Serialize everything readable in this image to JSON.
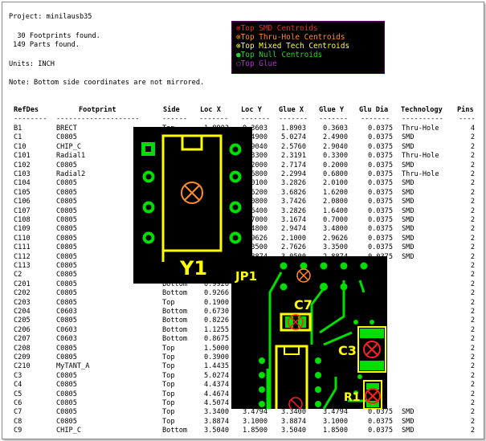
{
  "header": {
    "project": "Project: minilausb35",
    "footprints": "  30 Footprints found.",
    "parts": " 149 Parts found.",
    "units": "Units: INCH",
    "note": "Note: Bottom side coordinates are not mirrored."
  },
  "legend": [
    {
      "label": "Top SMD Centroids",
      "color": "#ff2020",
      "icon": "crossed-circle-icon"
    },
    {
      "label": "Top Thru-Hole Centroids",
      "color": "#ff8c2a",
      "icon": "crossed-circle-icon"
    },
    {
      "label": "Top Mixed Tech Centroids",
      "color": "#ffff40",
      "icon": "crossed-circle-icon"
    },
    {
      "label": "Top Null Centroids",
      "color": "#33cc33",
      "icon": "filled-circle-icon"
    },
    {
      "label": "Top Glue",
      "color": "#b030d0",
      "icon": "circle-icon"
    }
  ],
  "table": {
    "columns": [
      "RefDes",
      "Footprint",
      "Side",
      "Loc X",
      "Loc Y",
      "Glue X",
      "Glue Y",
      "Glu Dia",
      "Technology",
      "Pins"
    ],
    "dashes": [
      "--------",
      "--------------------",
      "------",
      "-------",
      "-------",
      "-------",
      "-------",
      "-------",
      "----------",
      "----"
    ],
    "rows": [
      [
        "B1",
        "BRECT",
        "Top",
        "1.8903",
        "0.3603",
        "1.8903",
        "0.3603",
        "0.0375",
        "Thru-Hole",
        "4"
      ],
      [
        "C1",
        "C0805",
        "Top",
        "5.0274",
        "2.4900",
        "5.0274",
        "2.4900",
        "0.0375",
        "SMD",
        "2"
      ],
      [
        "C10",
        "CHIP_C",
        "Top",
        "2.5760",
        "2.9040",
        "2.5760",
        "2.9040",
        "0.0375",
        "SMD",
        "2"
      ],
      [
        "C101",
        "Radial1",
        "Top",
        "2.3191",
        "0.3300",
        "2.3191",
        "0.3300",
        "0.0375",
        "Thru-Hole",
        "2"
      ],
      [
        "C102",
        "C0805",
        "Top",
        "2.7174",
        "0.2000",
        "2.7174",
        "0.2000",
        "0.0375",
        "SMD",
        "2"
      ],
      [
        "C103",
        "Radial2",
        "Top",
        "2.2994",
        "0.6800",
        "2.2994",
        "0.6800",
        "0.0375",
        "Thru-Hole",
        "2"
      ],
      [
        "C104",
        "C0805",
        "Top",
        "3.2826",
        "2.0100",
        "3.2826",
        "2.0100",
        "0.0375",
        "SMD",
        "2"
      ],
      [
        "C105",
        "C0805",
        "Top",
        "3.6826",
        "1.6200",
        "3.6826",
        "1.6200",
        "0.0375",
        "SMD",
        "2"
      ],
      [
        "C106",
        "C0805",
        "Top",
        "3.7426",
        "2.0800",
        "3.7426",
        "2.0800",
        "0.0375",
        "SMD",
        "2"
      ],
      [
        "C107",
        "C0805",
        "Top",
        "3.2826",
        "1.6400",
        "3.2826",
        "1.6400",
        "0.0375",
        "SMD",
        "2"
      ],
      [
        "C108",
        "C0805",
        "Top",
        "3.1674",
        "0.7000",
        "3.1674",
        "0.7000",
        "0.0375",
        "SMD",
        "2"
      ],
      [
        "C109",
        "C0805",
        "Top",
        "2.9474",
        "3.4800",
        "2.9474",
        "3.4800",
        "0.0375",
        "SMD",
        "2"
      ],
      [
        "C110",
        "C0805",
        "Top",
        "2.1000",
        "2.9626",
        "2.1000",
        "2.9626",
        "0.0375",
        "SMD",
        "2"
      ],
      [
        "C111",
        "C0805",
        "Top",
        "2.7626",
        "3.3500",
        "2.7626",
        "3.3500",
        "0.0375",
        "SMD",
        "2"
      ],
      [
        "C112",
        "C0805",
        "Top",
        "3.0500",
        "2.8874",
        "3.0500",
        "2.8874",
        "0.0375",
        "SMD",
        "2"
      ],
      [
        "C113",
        "C0805",
        "",
        "",
        "",
        "",
        "",
        "",
        "",
        "2"
      ],
      [
        "C2",
        "C0805",
        "",
        "",
        "",
        "",
        "",
        "",
        "",
        "2"
      ],
      [
        "C201",
        "C0805",
        "Bottom",
        "0.9926",
        "",
        "",
        "",
        "",
        "",
        "2"
      ],
      [
        "C202",
        "C0805",
        "Bottom",
        "0.9266",
        "",
        "",
        "",
        "",
        "",
        "2"
      ],
      [
        "C203",
        "C0805",
        "Top",
        "0.1900",
        "",
        "",
        "",
        "",
        "",
        "2"
      ],
      [
        "C204",
        "C0603",
        "Bottom",
        "0.6730",
        "",
        "",
        "",
        "",
        "",
        "2"
      ],
      [
        "C205",
        "C0805",
        "Bottom",
        "0.8226",
        "",
        "",
        "",
        "",
        "",
        "2"
      ],
      [
        "C206",
        "C0603",
        "Bottom",
        "1.1255",
        "",
        "",
        "",
        "",
        "",
        "2"
      ],
      [
        "C207",
        "C0603",
        "Bottom",
        "0.8675",
        "",
        "",
        "",
        "",
        "",
        "2"
      ],
      [
        "C208",
        "C0805",
        "Top",
        "1.5000",
        "",
        "",
        "",
        "",
        "",
        "2"
      ],
      [
        "C209",
        "C0805",
        "Top",
        "0.3900",
        "",
        "",
        "",
        "",
        "",
        "2"
      ],
      [
        "C210",
        "MyTANT_A",
        "Top",
        "1.4435",
        "",
        "",
        "",
        "",
        "",
        "2"
      ],
      [
        "C3",
        "C0805",
        "Top",
        "5.0274",
        "",
        "",
        "",
        "",
        "",
        "2"
      ],
      [
        "C4",
        "C0805",
        "Top",
        "4.4374",
        "",
        "",
        "",
        "",
        "",
        "2"
      ],
      [
        "C5",
        "C0805",
        "Top",
        "4.4674",
        "",
        "",
        "",
        "",
        "",
        "2"
      ],
      [
        "C6",
        "C0805",
        "Top",
        "4.5074",
        "",
        "",
        "",
        "",
        "",
        "2"
      ],
      [
        "C7",
        "C0805",
        "Top",
        "3.3400",
        "3.4794",
        "3.3400",
        "3.4794",
        "0.0375",
        "SMD",
        "2"
      ],
      [
        "C8",
        "C0805",
        "Top",
        "3.8874",
        "3.1000",
        "3.8874",
        "3.1000",
        "0.0375",
        "SMD",
        "2"
      ],
      [
        "C9",
        "CHIP_C",
        "Bottom",
        "3.5040",
        "1.8500",
        "3.5040",
        "1.8500",
        "0.0375",
        "SMD",
        "2"
      ]
    ]
  },
  "pcb_labels": {
    "y1": "Y1",
    "jp1": "JP1",
    "c7": "C7",
    "c3": "C3",
    "r1": "R1"
  },
  "colors": {
    "copper": "#00dd00",
    "silkscreen": "#ffff00",
    "smd_centroid": "#ff2020",
    "thru_centroid": "#ff8c2a",
    "pcb_background": "#000000"
  }
}
